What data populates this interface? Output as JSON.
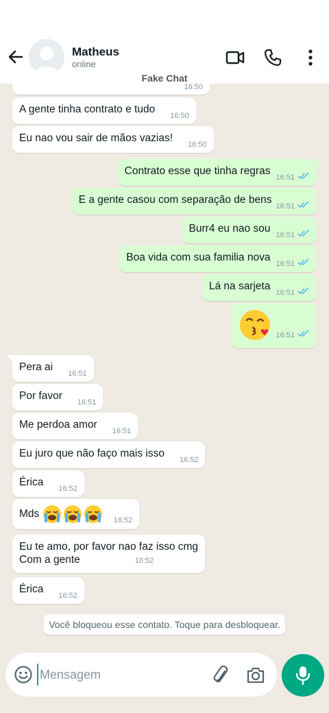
{
  "header": {
    "name": "Matheus",
    "status": "online",
    "watermark": "Fake Chat"
  },
  "messages": [
    {
      "dir": "in",
      "text": "A gente tinha contrato e tudo",
      "time": "16:50"
    },
    {
      "dir": "in",
      "text": "Eu nao vou sair de mãos vazias!",
      "time": "16:50"
    },
    {
      "dir": "out",
      "text": "Contrato esse que tinha regras",
      "time": "16:51"
    },
    {
      "dir": "out",
      "text": "E a gente casou com separação de bens",
      "time": "16:51"
    },
    {
      "dir": "out",
      "text": "Burr4 eu nao sou",
      "time": "16:51"
    },
    {
      "dir": "out",
      "text": "Boa vida com sua familia nova",
      "time": "16:51"
    },
    {
      "dir": "out",
      "text": "Lá na sarjeta",
      "time": "16:51"
    },
    {
      "dir": "out",
      "text": "",
      "emoji": "face-blowing-kiss",
      "time": "16:51"
    },
    {
      "dir": "in",
      "text": "Pera ai",
      "time": "16:51"
    },
    {
      "dir": "in",
      "text": "Por favor",
      "time": "16:51"
    },
    {
      "dir": "in",
      "text": "Me perdoa amor",
      "time": "16:51"
    },
    {
      "dir": "in",
      "text": "Eu juro que não faço mais isso",
      "time": "16:52"
    },
    {
      "dir": "in",
      "text": "Érica",
      "time": "16:52"
    },
    {
      "dir": "in",
      "text": "Mds",
      "emoji": "loudly-crying-face x3",
      "time": "16:52"
    },
    {
      "dir": "in",
      "text": "Eu te amo, por favor nao faz isso cmg",
      "text2": "Com a gente",
      "time": "16:52"
    },
    {
      "dir": "in",
      "text": "Érica",
      "time": "16:52"
    }
  ],
  "partial_top_time": "16:50",
  "notice": "Você bloqueou esse contato. Toque para desbloquear.",
  "composer": {
    "placeholder": "Mensagem"
  },
  "colors": {
    "incoming": "#ffffff",
    "outgoing": "#d9fdd3",
    "background": "#efeae2",
    "accent": "#00a884",
    "read_ticks": "#53bdeb"
  },
  "icons": [
    "back-arrow-icon",
    "video-call-icon",
    "phone-icon",
    "more-options-icon",
    "emoji-icon",
    "attach-icon",
    "camera-icon",
    "mic-icon"
  ]
}
